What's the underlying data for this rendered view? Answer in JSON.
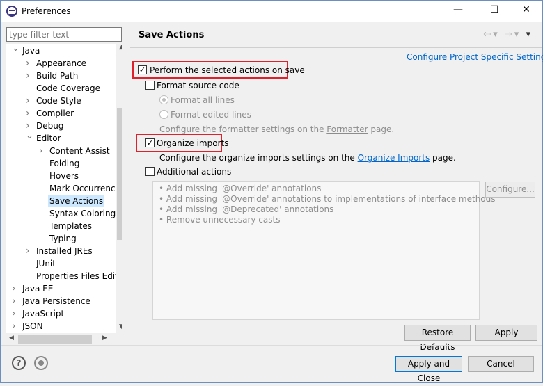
{
  "window": {
    "title": "Preferences",
    "minimize": "—",
    "maximize": "☐",
    "close": "✕"
  },
  "sidebar": {
    "filter_placeholder": "type filter text",
    "items": [
      {
        "label": "Java",
        "level": 0,
        "chevron": "v"
      },
      {
        "label": "Appearance",
        "level": 1,
        "chevron": ">"
      },
      {
        "label": "Build Path",
        "level": 1,
        "chevron": ">"
      },
      {
        "label": "Code Coverage",
        "level": 1,
        "chevron": ""
      },
      {
        "label": "Code Style",
        "level": 1,
        "chevron": ">"
      },
      {
        "label": "Compiler",
        "level": 1,
        "chevron": ">"
      },
      {
        "label": "Debug",
        "level": 1,
        "chevron": ">"
      },
      {
        "label": "Editor",
        "level": 1,
        "chevron": "v"
      },
      {
        "label": "Content Assist",
        "level": 2,
        "chevron": ">"
      },
      {
        "label": "Folding",
        "level": 2,
        "chevron": ""
      },
      {
        "label": "Hovers",
        "level": 2,
        "chevron": ""
      },
      {
        "label": "Mark Occurrences",
        "level": 2,
        "chevron": ""
      },
      {
        "label": "Save Actions",
        "level": 2,
        "chevron": "",
        "selected": true
      },
      {
        "label": "Syntax Coloring",
        "level": 2,
        "chevron": ""
      },
      {
        "label": "Templates",
        "level": 2,
        "chevron": ""
      },
      {
        "label": "Typing",
        "level": 2,
        "chevron": ""
      },
      {
        "label": "Installed JREs",
        "level": 1,
        "chevron": ">"
      },
      {
        "label": "JUnit",
        "level": 1,
        "chevron": ""
      },
      {
        "label": "Properties Files Editor",
        "level": 1,
        "chevron": ""
      },
      {
        "label": "Java EE",
        "level": 0,
        "chevron": ">"
      },
      {
        "label": "Java Persistence",
        "level": 0,
        "chevron": ">"
      },
      {
        "label": "JavaScript",
        "level": 0,
        "chevron": ">"
      },
      {
        "label": "JSON",
        "level": 0,
        "chevron": ">"
      }
    ]
  },
  "page": {
    "title": "Save Actions",
    "configure_link": "Configure Project Specific Settings...",
    "perform": {
      "label": "Perform the selected actions on save",
      "checked": true
    },
    "format_source": {
      "label": "Format source code",
      "checked": false
    },
    "format_all": {
      "label": "Format all lines",
      "selected": true
    },
    "format_edited": {
      "label": "Format edited lines",
      "selected": false
    },
    "formatter_text_pre": "Configure the formatter settings on the ",
    "formatter_link": "Formatter",
    "formatter_text_post": " page.",
    "organize": {
      "label": "Organize imports",
      "checked": true
    },
    "organize_text_pre": "Configure the organize imports settings on the ",
    "organize_link": "Organize Imports",
    "organize_text_post": " page.",
    "additional": {
      "label": "Additional actions",
      "checked": false
    },
    "additional_list": [
      "Add missing '@Override' annotations",
      "Add missing '@Override' annotations to implementations of interface methods",
      "Add missing '@Deprecated' annotations",
      "Remove unnecessary casts"
    ],
    "configure_button": "Configure...",
    "restore_defaults": "Restore Defaults",
    "apply": "Apply"
  },
  "footer": {
    "apply_close": "Apply and Close",
    "cancel": "Cancel",
    "help": "?"
  },
  "colors": {
    "highlight": "#e0202a",
    "link": "#0066cc",
    "selection": "#cce8ff"
  }
}
